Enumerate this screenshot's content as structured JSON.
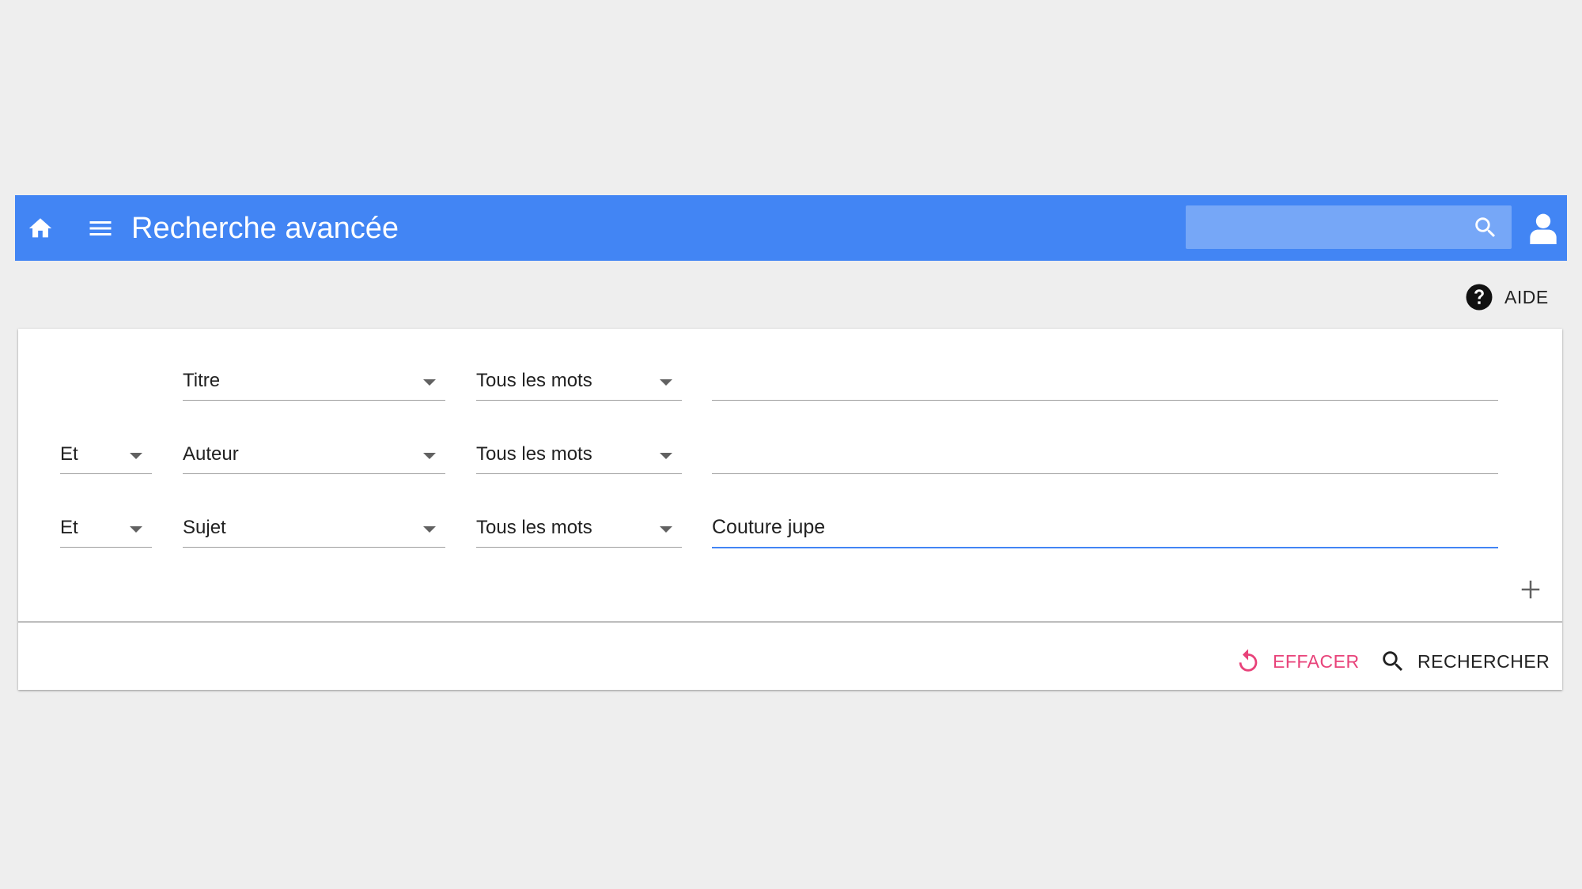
{
  "app_bar": {
    "title": "Recherche avancée",
    "search_placeholder": "",
    "color": "#4285f4"
  },
  "help": {
    "label": "AIDE"
  },
  "form": {
    "rows": [
      {
        "operator": "",
        "field": "Titre",
        "mode": "Tous les mots",
        "value": ""
      },
      {
        "operator": "Et",
        "field": "Auteur",
        "mode": "Tous les mots",
        "value": ""
      },
      {
        "operator": "Et",
        "field": "Sujet",
        "mode": "Tous les mots",
        "value": "Couture jupe"
      }
    ]
  },
  "actions": {
    "clear_label": "EFFACER",
    "search_label": "RECHERCHER",
    "clear_color": "#e8437a"
  },
  "icons": [
    "home-icon",
    "menu-icon",
    "search-icon",
    "account-icon",
    "help-icon",
    "plus-icon",
    "reset-icon"
  ]
}
